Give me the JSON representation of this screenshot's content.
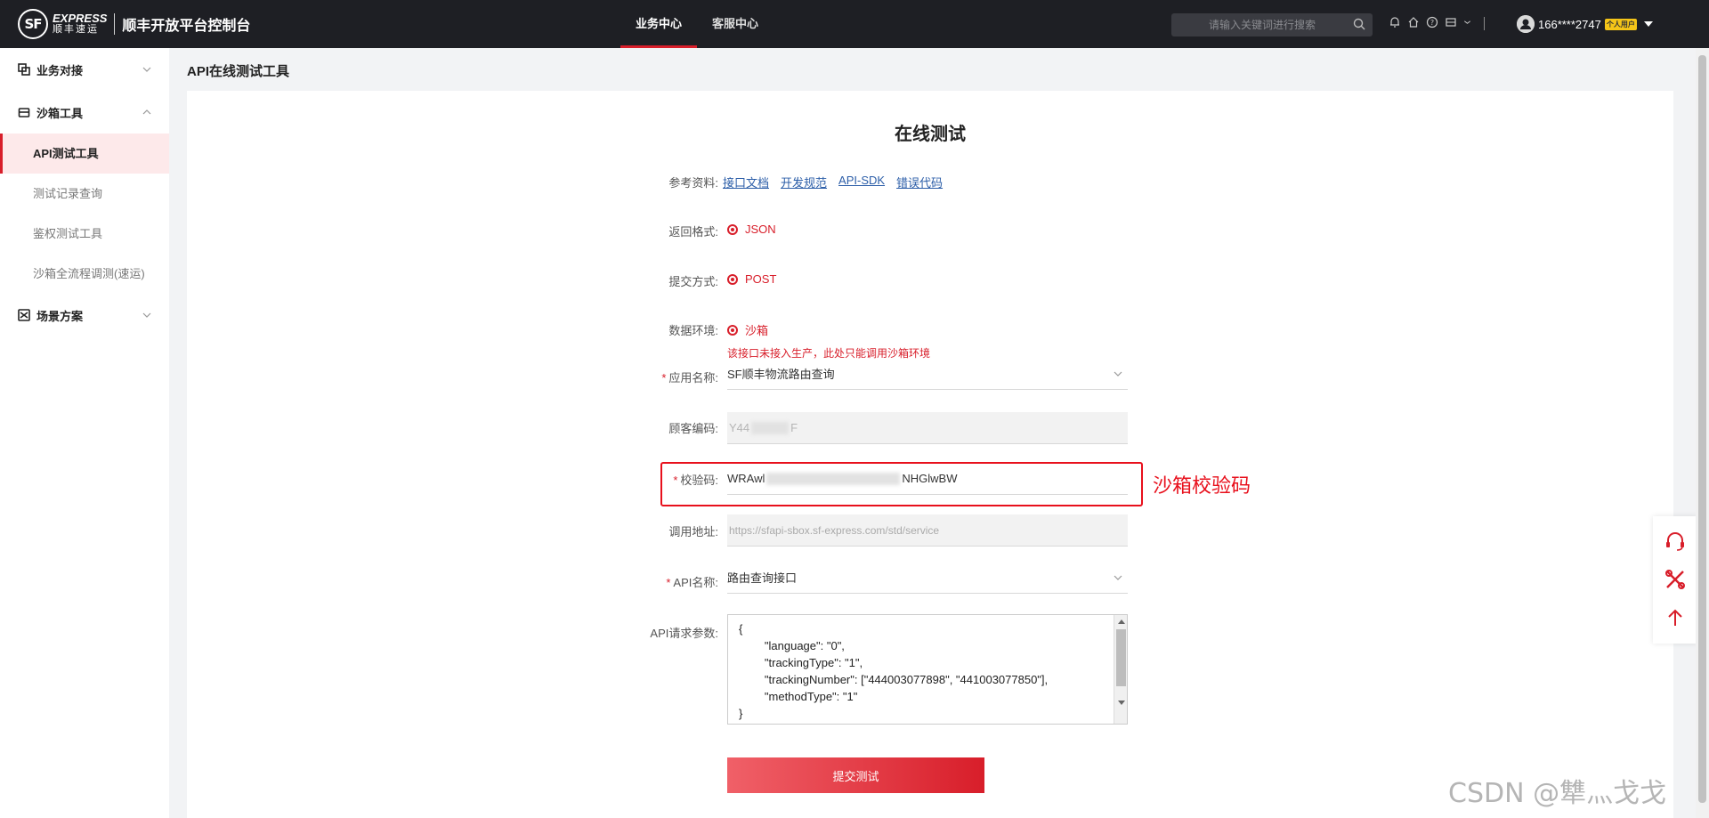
{
  "header": {
    "logo_mark": "SF",
    "logo_en": "EXPRESS",
    "logo_cn": "顺丰速运",
    "title": "顺丰开放平台控制台",
    "nav": [
      {
        "label": "业务中心",
        "active": true
      },
      {
        "label": "客服中心",
        "active": false
      }
    ],
    "search_placeholder": "请输入关键词进行搜索",
    "user": "166****2747",
    "user_badge": "个人用户"
  },
  "sidebar": {
    "groups": [
      {
        "label": "业务对接",
        "expanded": false
      },
      {
        "label": "沙箱工具",
        "expanded": true,
        "items": [
          {
            "label": "API测试工具",
            "active": true
          },
          {
            "label": "测试记录查询",
            "active": false
          },
          {
            "label": "鉴权测试工具",
            "active": false
          },
          {
            "label": "沙箱全流程调测(速运)",
            "active": false
          }
        ]
      },
      {
        "label": "场景方案",
        "expanded": false
      }
    ]
  },
  "main": {
    "page_title": "API在线测试工具",
    "card_title": "在线测试",
    "reference_label": "参考资料:",
    "reference_links": [
      "接口文档",
      "开发规范",
      "API-SDK",
      "错误代码"
    ],
    "return_format_label": "返回格式:",
    "return_format": "JSON",
    "submit_method_label": "提交方式:",
    "submit_method": "POST",
    "env_label": "数据环境:",
    "env": "沙箱",
    "env_warning": "该接口未接入生产，此处只能调用沙箱环境",
    "app_label": "应用名称:",
    "app_value": "SF顺丰物流路由查询",
    "customer_label": "顾客编码:",
    "customer_prefix": "Y44",
    "customer_suffix": "F",
    "checkcode_label": "校验码:",
    "checkcode_prefix": "WRAwl",
    "checkcode_suffix": "NHGlwBW",
    "url_label": "调用地址:",
    "url_placeholder": "https://sfapi-sbox.sf-express.com/std/service",
    "api_label": "API名称:",
    "api_value": "路由查询接口",
    "params_label": "API请求参数:",
    "params_value": "{\n        \"language\": \"0\",\n        \"trackingType\": \"1\",\n        \"trackingNumber\": [\"444003077898\", \"441003077850\"],\n        \"methodType\": \"1\"\n}",
    "submit_label": "提交测试",
    "annotation": "沙箱校验码"
  },
  "watermark": "CSDN @犨灬戈戈",
  "colors": {
    "brand_red": "#d81e2a",
    "header_bg": "#1e1f24"
  }
}
